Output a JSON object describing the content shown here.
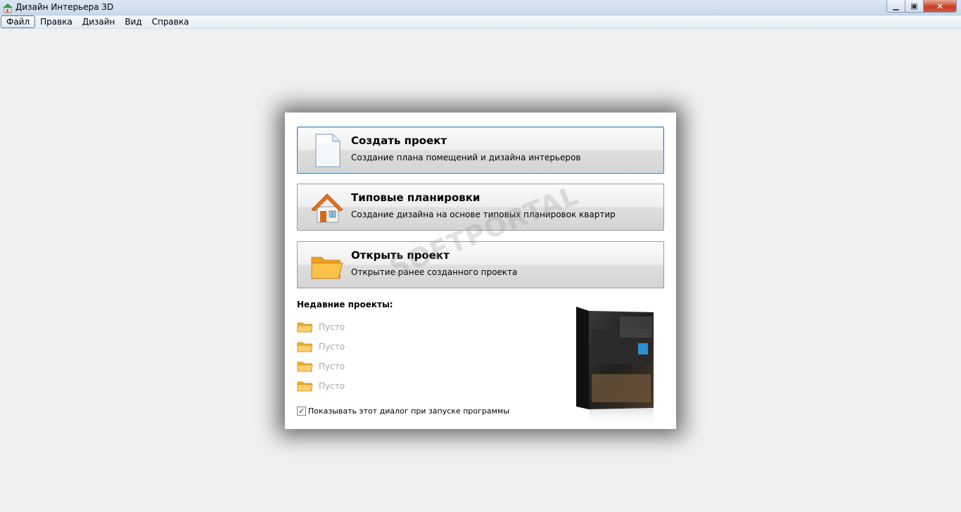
{
  "window": {
    "title": "Дизайн Интерьера 3D",
    "min_glyph": "▁",
    "max_glyph": "▣",
    "close_glyph": "✕"
  },
  "menu": {
    "items": [
      "Файл",
      "Правка",
      "Дизайн",
      "Вид",
      "Справка"
    ]
  },
  "dialog": {
    "actions": [
      {
        "title": "Создать проект",
        "description": "Создание плана помещений и дизайна интерьеров",
        "icon": "new-document-icon"
      },
      {
        "title": "Типовые планировки",
        "description": "Создание дизайна на основе типовых планировок квартир",
        "icon": "house-icon"
      },
      {
        "title": "Открыть проект",
        "description": "Открытие ранее созданного проекта",
        "icon": "open-folder-icon"
      }
    ],
    "recent_title": "Недавние проекты:",
    "recent_items": [
      "Пусто",
      "Пусто",
      "Пусто",
      "Пусто"
    ],
    "startup_checkbox": {
      "label": "Показывать этот диалог при запуске программы",
      "checked": true,
      "check_glyph": "✓"
    }
  },
  "watermark": {
    "text": "SOFTPORTAL"
  },
  "colors": {
    "focus_border": "#3c7fb1",
    "folder": "#f5b532",
    "close_button": "#c7402a"
  }
}
